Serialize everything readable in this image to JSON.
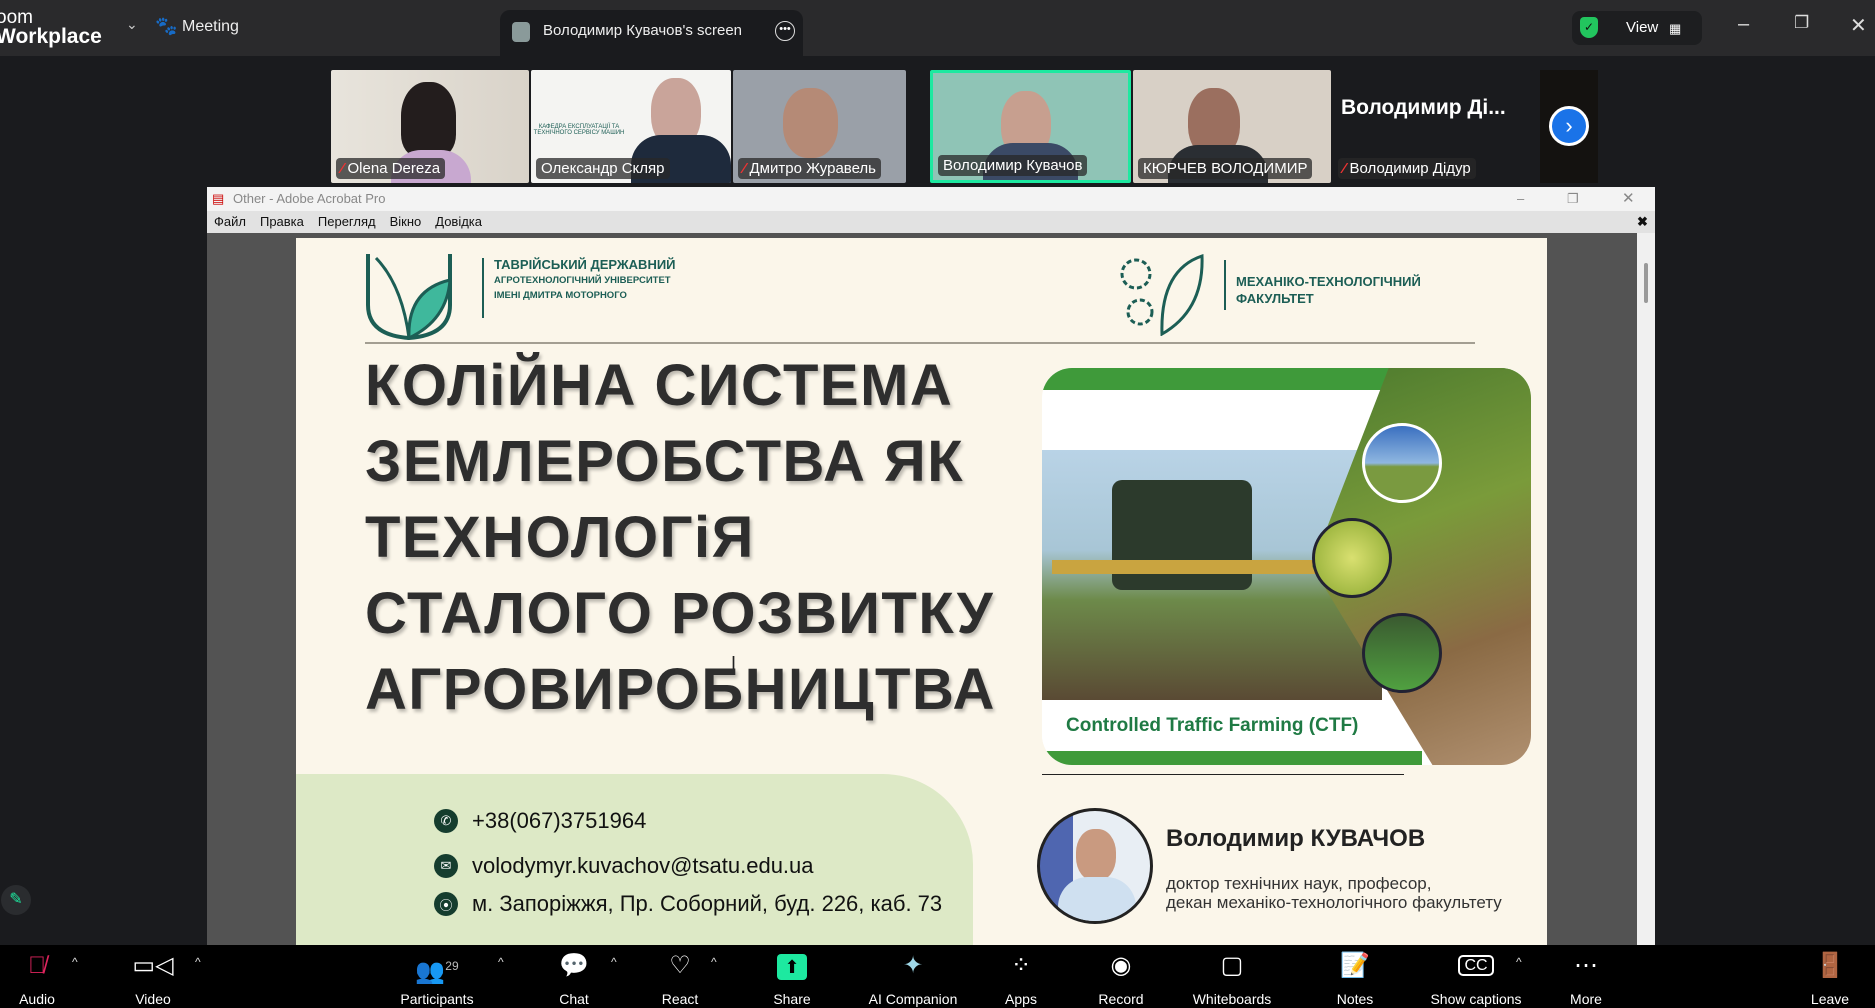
{
  "app": {
    "brand_line1": "oom",
    "brand_line2": "Workplace",
    "meeting_label": "Meeting",
    "screen_tab": "Володимир Кувачов's screen",
    "view_label": "View"
  },
  "participants": [
    {
      "name": "Olena Dereza",
      "muted": true
    },
    {
      "name": "Олександр Скляр",
      "muted": false
    },
    {
      "name": "Дмитро Журавель",
      "muted": true
    },
    {
      "name": "Володимир Кувачов",
      "muted": false,
      "active": true
    },
    {
      "name": "КЮРЧЕВ ВОЛОДИМИР",
      "muted": false
    },
    {
      "name": "Володимир Дідур",
      "muted": true,
      "tile_label": "Володимир Ді..."
    }
  ],
  "thumb_logo_text": "КАФЕДРА ЕКСПЛУАТАЦІЇ ТА ТЕХНІЧНОГО СЕРВІСУ МАШИН",
  "acrobat": {
    "title": "Other - Adobe Acrobat Pro",
    "menu": [
      "Файл",
      "Правка",
      "Перегляд",
      "Вікно",
      "Довідка"
    ]
  },
  "slide": {
    "uni": [
      "ТАВРІЙСЬКИЙ ДЕРЖАВНИЙ",
      "АГРОТЕХНОЛОГІЧНИЙ УНІВЕРСИТЕТ",
      "ІМЕНІ ДМИТРА МОТОРНОГО"
    ],
    "faculty": [
      "МЕХАНІКО-ТЕХНОЛОГІЧНИЙ",
      "ФАКУЛЬТЕТ"
    ],
    "title": [
      "КОЛіЙНА СИСТЕМА",
      "ЗЕМЛЕРОБСТВА ЯК",
      "ТЕХНОЛОГіЯ",
      "СТАЛОГО РОЗВИТКУ",
      "АГРОВИРОБНИЦТВА"
    ],
    "image_caption": "Controlled Traffic Farming (CTF)",
    "phone": "+38(067)3751964",
    "email": "volodymyr.kuvachov@tsatu.edu.ua",
    "address": "м. Запоріжжя, Пр. Соборний, буд. 226, каб. 73",
    "speaker_name": "Володимир КУВАЧОВ",
    "speaker_role1": "доктор технічних наук, професор,",
    "speaker_role2": "декан механіко-технологічного факультету"
  },
  "toolbar": {
    "audio": "Audio",
    "video": "Video",
    "participants": "Participants",
    "participants_count": "29",
    "chat": "Chat",
    "react": "React",
    "share": "Share",
    "ai": "AI Companion",
    "apps": "Apps",
    "record": "Record",
    "whiteboards": "Whiteboards",
    "notes": "Notes",
    "captions": "Show captions",
    "more": "More",
    "leave": "Leave"
  },
  "colors": {
    "active_speaker": "#1de9a0",
    "share": "#1de9a0",
    "slide_green": "#1c5e55",
    "leave": "#e0245e"
  }
}
